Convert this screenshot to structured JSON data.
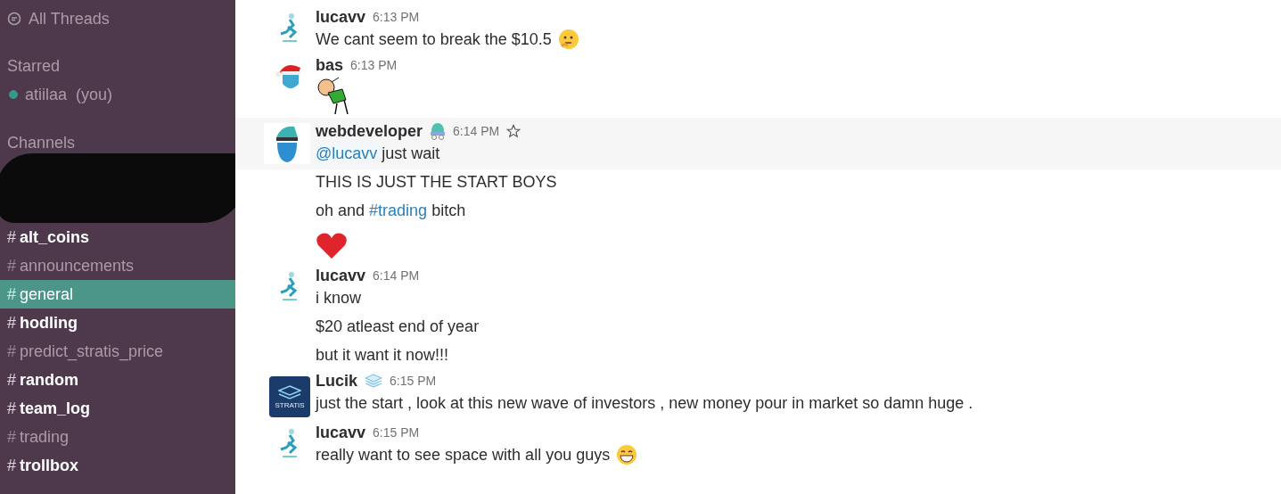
{
  "sidebar": {
    "all_threads": "All Threads",
    "starred": {
      "heading": "Starred",
      "items": [
        {
          "name": "atiilaa",
          "suffix": "(you)",
          "online": true
        }
      ]
    },
    "channels": {
      "heading": "Channels",
      "items": [
        {
          "name": "alt_coins",
          "unread": true,
          "selected": false,
          "redacted": true
        },
        {
          "name": "announcements",
          "unread": false,
          "selected": false
        },
        {
          "name": "general",
          "unread": false,
          "selected": true
        },
        {
          "name": "hodling",
          "unread": true,
          "selected": false
        },
        {
          "name": "predict_stratis_price",
          "unread": false,
          "selected": false
        },
        {
          "name": "random",
          "unread": true,
          "selected": false
        },
        {
          "name": "team_log",
          "unread": true,
          "selected": false
        },
        {
          "name": "trading",
          "unread": false,
          "selected": false
        },
        {
          "name": "trollbox",
          "unread": true,
          "selected": false
        }
      ]
    },
    "hash": "#"
  },
  "messages": [
    {
      "author": "lucavv",
      "time": "6:13 PM",
      "avatar": {
        "kind": "logo"
      },
      "highlighted": false,
      "lines": [
        [
          {
            "kind": "text",
            "text": "We cant seem to break the $10.5 "
          },
          {
            "kind": "thinking-emoji"
          }
        ]
      ]
    },
    {
      "author": "bas",
      "time": "6:13 PM",
      "avatar": {
        "kind": "santa"
      },
      "highlighted": false,
      "lines": [
        [
          {
            "kind": "sticker"
          }
        ]
      ]
    },
    {
      "author": "webdeveloper",
      "time": "6:14 PM",
      "avatar": {
        "kind": "hat"
      },
      "badge": {
        "kind": "hat"
      },
      "starrable": true,
      "highlighted": true,
      "lines": [
        [
          {
            "kind": "mention",
            "text": "@lucavv"
          },
          {
            "kind": "text",
            "text": " just wait"
          }
        ],
        [
          {
            "kind": "text",
            "text": "THIS IS JUST THE START BOYS"
          }
        ],
        [
          {
            "kind": "text",
            "text": "oh and "
          },
          {
            "kind": "channel",
            "text": "#trading"
          },
          {
            "kind": "text",
            "text": " bitch"
          }
        ],
        [
          {
            "kind": "heart-emoji"
          }
        ]
      ]
    },
    {
      "author": "lucavv",
      "time": "6:14 PM",
      "avatar": {
        "kind": "logo"
      },
      "highlighted": false,
      "lines": [
        [
          {
            "kind": "text",
            "text": "i know"
          }
        ],
        [
          {
            "kind": "text",
            "text": "$20 atleast end of year"
          }
        ],
        [
          {
            "kind": "text",
            "text": "but it want it now!!!"
          }
        ]
      ]
    },
    {
      "author": "Lucik",
      "time": "6:15 PM",
      "avatar": {
        "kind": "stratis",
        "text": "STRATIS"
      },
      "badge": {
        "kind": "layers"
      },
      "highlighted": false,
      "lines": [
        [
          {
            "kind": "text",
            "text": "just the start , look at this new wave of investors , new money pour in market so damn huge ."
          }
        ]
      ]
    },
    {
      "author": "lucavv",
      "time": "6:15 PM",
      "avatar": {
        "kind": "logo"
      },
      "highlighted": false,
      "lines": [
        [
          {
            "kind": "text",
            "text": "really want to see space with all you guys "
          },
          {
            "kind": "grin-emoji"
          }
        ]
      ]
    }
  ]
}
